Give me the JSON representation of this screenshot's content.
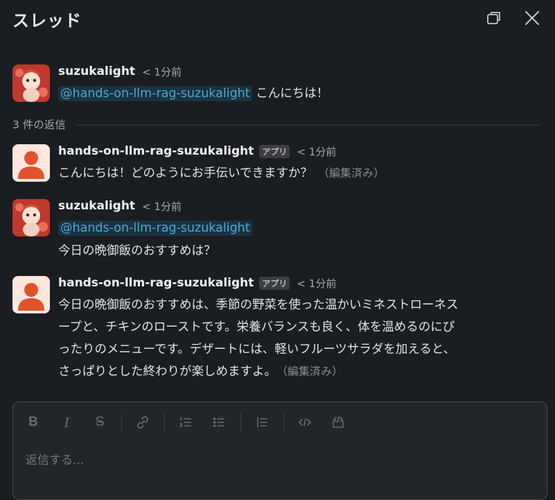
{
  "header": {
    "title": "スレッド"
  },
  "divider": {
    "label": "3 件の返信"
  },
  "messages": [
    {
      "author": "suzukalight",
      "time": "< 1分前",
      "mention": "@hands-on-llm-rag-suzukalight",
      "text": "こんにちは！"
    },
    {
      "author": "hands-on-llm-rag-suzukalight",
      "badge": "アプリ",
      "time": "< 1分前",
      "text": "こんにちは！どのようにお手伝いできますか？",
      "edited": "（編集済み）"
    },
    {
      "author": "suzukalight",
      "time": "< 1分前",
      "mention": "@hands-on-llm-rag-suzukalight",
      "text": "今日の晩御飯のおすすめは？"
    },
    {
      "author": "hands-on-llm-rag-suzukalight",
      "badge": "アプリ",
      "time": "< 1分前",
      "lines": [
        "今日の晩御飯のおすすめは、季節の野菜を使った温かいミネストローネス",
        "ープと、チキンのローストです。栄養バランスも良く、体を温めるのにぴ",
        "ったりのメニューです。デザートには、軽いフルーツサラダを加えると、",
        "さっぱりとした終わりが楽しめますよ。"
      ],
      "edited": "（編集済み）"
    }
  ],
  "composer": {
    "placeholder": "返信する..."
  },
  "colors": {
    "background": "#1a1d21",
    "mention": "#4aa8d8",
    "app_avatar": "#e0532a"
  }
}
